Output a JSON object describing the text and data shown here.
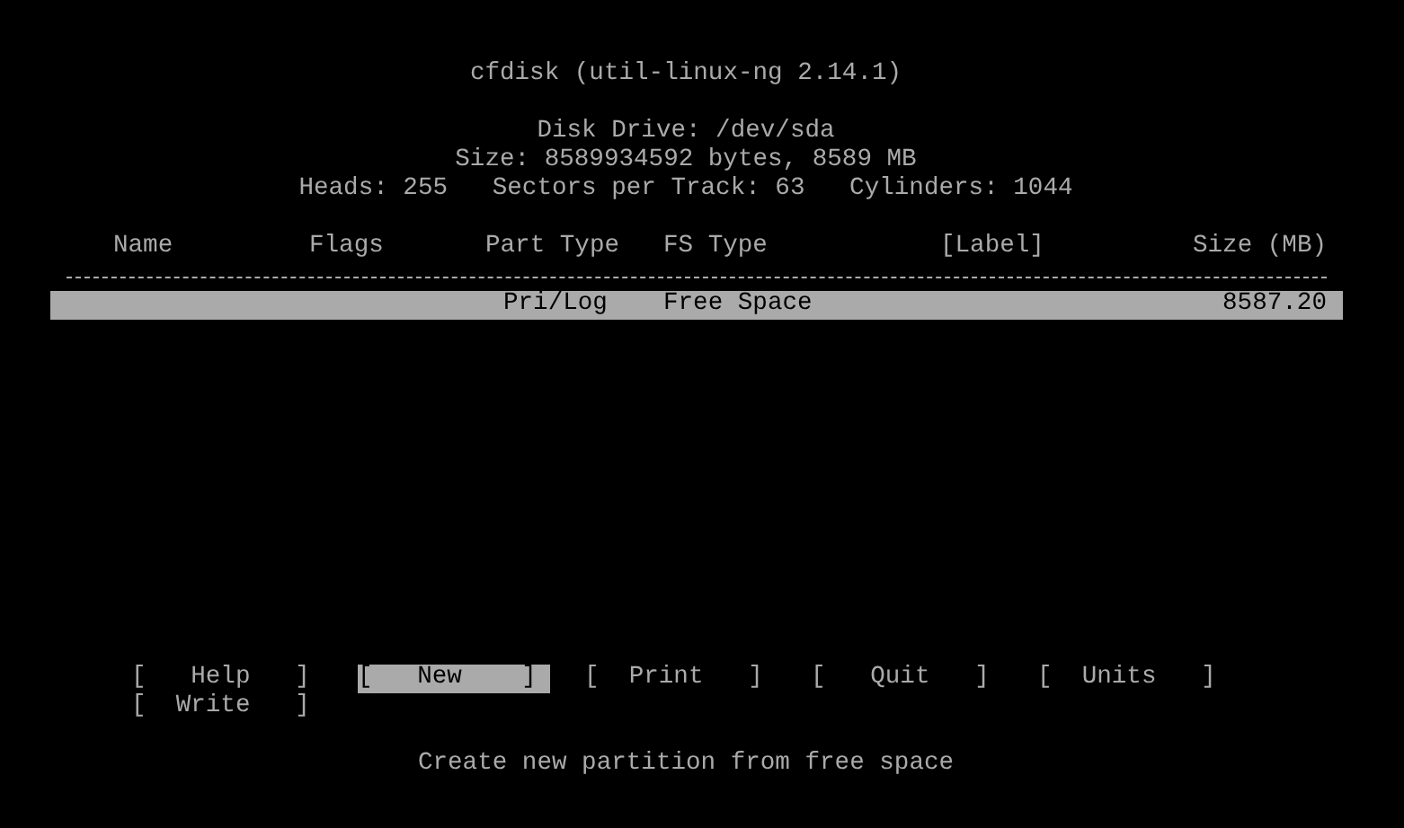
{
  "title": "cfdisk (util-linux-ng 2.14.1)",
  "disk": {
    "drive": "Disk Drive: /dev/sda",
    "size": "Size: 8589934592 bytes, 8589 MB",
    "geometry": "Heads: 255   Sectors per Track: 63   Cylinders: 1044"
  },
  "table": {
    "columns": [
      "Name",
      "Flags",
      "Part Type",
      "FS Type",
      "[Label]",
      "Size (MB)"
    ],
    "rows": [
      {
        "part_type": "Pri/Log",
        "fs_type": "Free Space",
        "size": "8587.20",
        "selected": true
      }
    ]
  },
  "buttons": [
    {
      "label": "[   Help   ]",
      "selected": false
    },
    {
      "label": "[   New    ]",
      "selected": true
    },
    {
      "label": "[  Print   ]",
      "selected": false
    },
    {
      "label": "[   Quit   ]",
      "selected": false
    },
    {
      "label": "[  Units   ]",
      "selected": false
    },
    {
      "label": "[  Write   ]",
      "selected": false
    }
  ],
  "status": "Create new partition from free space"
}
